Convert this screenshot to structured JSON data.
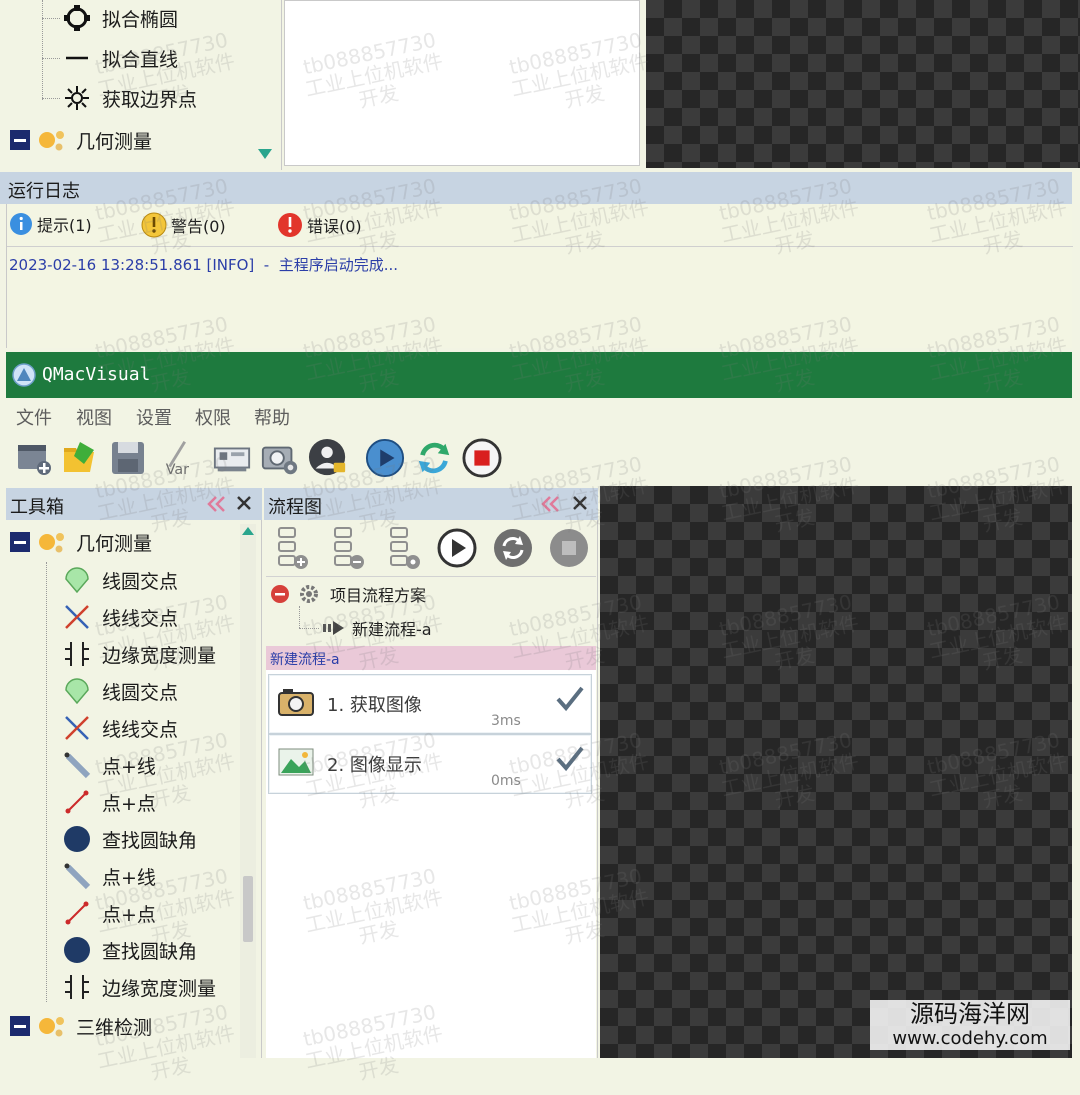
{
  "top_toolbox": {
    "items": [
      {
        "label": "拟合椭圆",
        "icon": "ellipse-icon"
      },
      {
        "label": "拟合直线",
        "icon": "line-icon"
      },
      {
        "label": "获取边界点",
        "icon": "boundary-points-icon"
      }
    ],
    "group": {
      "label": "几何测量",
      "icon": "geometry-group-icon"
    }
  },
  "log": {
    "title": "运行日志",
    "filters": [
      {
        "label": "提示(1)",
        "icon": "info-icon",
        "color": "#3a8fe0"
      },
      {
        "label": "警告(0)",
        "icon": "warning-icon",
        "color": "#f3c63a"
      },
      {
        "label": "错误(0)",
        "icon": "error-icon",
        "color": "#e2352b"
      }
    ],
    "entries": [
      "2023-02-16 13:28:51.861 [INFO]  -  主程序启动完成..."
    ]
  },
  "app": {
    "title": "QMacVisual",
    "title_bar_color": "#1e7a3e",
    "menu": [
      "文件",
      "视图",
      "设置",
      "权限",
      "帮助"
    ],
    "toolbar": [
      {
        "name": "new-project-button",
        "icon": "new-project-icon"
      },
      {
        "name": "open-project-button",
        "icon": "open-folder-icon"
      },
      {
        "name": "save-button",
        "icon": "save-icon"
      },
      {
        "name": "variable-button",
        "icon": "variable-icon",
        "text": "Var"
      },
      {
        "name": "hardware-button",
        "icon": "card-icon"
      },
      {
        "name": "camera-settings-button",
        "icon": "camera-gear-icon"
      },
      {
        "name": "user-permission-button",
        "icon": "user-lock-icon"
      },
      {
        "name": "run-once-button",
        "icon": "play-icon"
      },
      {
        "name": "run-loop-button",
        "icon": "refresh-icon"
      },
      {
        "name": "stop-button",
        "icon": "stop-icon"
      }
    ]
  },
  "toolbox": {
    "title": "工具箱",
    "groups": [
      {
        "label": "几何测量",
        "items": [
          {
            "label": "线圆交点",
            "icon": "line-circle-intersect-icon"
          },
          {
            "label": "线线交点",
            "icon": "line-line-intersect-icon"
          },
          {
            "label": "边缘宽度测量",
            "icon": "edge-width-icon"
          },
          {
            "label": "线圆交点",
            "icon": "line-circle-intersect-icon"
          },
          {
            "label": "线线交点",
            "icon": "line-line-intersect-icon"
          },
          {
            "label": "点+线",
            "icon": "point-line-icon"
          },
          {
            "label": "点+点",
            "icon": "point-point-icon"
          },
          {
            "label": "查找圆缺角",
            "icon": "circle-notch-icon"
          },
          {
            "label": "点+线",
            "icon": "point-line-icon"
          },
          {
            "label": "点+点",
            "icon": "point-point-icon"
          },
          {
            "label": "查找圆缺角",
            "icon": "circle-notch-icon"
          },
          {
            "label": "边缘宽度测量",
            "icon": "edge-width-icon"
          }
        ]
      },
      {
        "label": "三维检测",
        "items": []
      }
    ]
  },
  "flow": {
    "title": "流程图",
    "project": "项目流程方案",
    "process": "新建流程-a",
    "current_tab": "新建流程-a",
    "steps": [
      {
        "label": "1. 获取图像",
        "time": "3ms",
        "icon": "camera-icon"
      },
      {
        "label": "2. 图像显示",
        "time": "0ms",
        "icon": "image-icon"
      }
    ]
  },
  "watermarks": {
    "text": "tb088857730\n工业上位机软件\n开发",
    "site_name": "源码海洋网",
    "site_url": "www.codehy.com"
  }
}
